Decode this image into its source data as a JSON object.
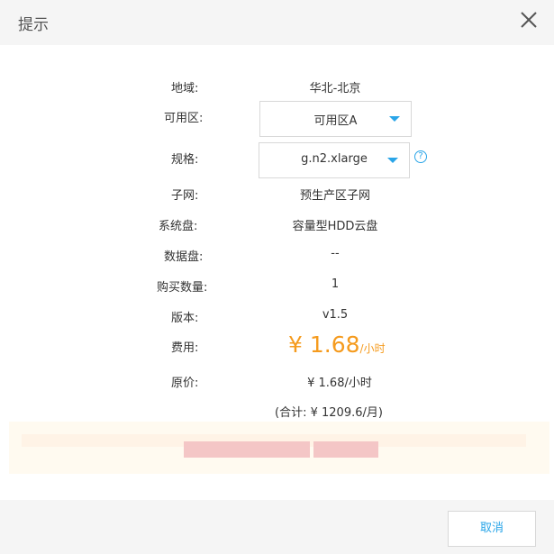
{
  "dialog": {
    "title": "提示",
    "close_icon": "close-icon"
  },
  "form": {
    "region_label": "地域:",
    "region_value": "华北-北京",
    "zone_label": "可用区:",
    "zone_selected": "可用区A",
    "spec_label": "规格:",
    "spec_selected": "g.n2.xlarge",
    "help_icon": "question-circle-icon",
    "help_glyph": "?",
    "subnet_label": "子网:",
    "subnet_value": "预生产区子网",
    "system_disk_label": "系统盘:",
    "system_disk_value": "容量型HDD云盘",
    "data_disk_label": "数据盘:",
    "data_disk_value": "--",
    "quantity_label": "购买数量:",
    "quantity_value": "1",
    "version_label": "版本:",
    "version_value": "v1.5",
    "fee_label": "费用:",
    "fee_value": "¥ 1.68",
    "fee_unit": "/小时",
    "original_price_label": "原价:",
    "original_price_value": "¥ 1.68/小时",
    "total_value": "(合计:  ¥ 1209.6/月)"
  },
  "footer": {
    "cancel_label": "取消"
  },
  "colors": {
    "accent": "#2aa5e8",
    "price": "#f59b1e",
    "header_bg": "#f5f5f5"
  }
}
